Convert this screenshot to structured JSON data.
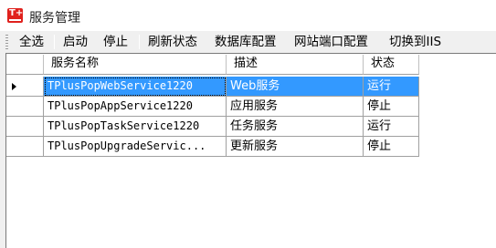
{
  "window": {
    "title": "服务管理",
    "icon": "app-logo-icon"
  },
  "toolbar": {
    "select_all": "全选",
    "start": "启动",
    "stop": "停止",
    "refresh": "刷新状态",
    "db_config": "数据库配置",
    "site_port_config": "网站端口配置",
    "switch_iis": "切换到IIS"
  },
  "grid": {
    "columns": [
      "服务名称",
      "描述",
      "状态"
    ],
    "selected_row": 0,
    "rows": [
      {
        "name": "TPlusPopWebService1220",
        "desc": "Web服务",
        "status": "运行"
      },
      {
        "name": "TPlusPopAppService1220",
        "desc": "应用服务",
        "status": "停止"
      },
      {
        "name": "TPlusPopTaskService1220",
        "desc": "任务服务",
        "status": "运行"
      },
      {
        "name": "TPlusPopUpgradeServic...",
        "desc": "更新服务",
        "status": "停止"
      }
    ]
  },
  "colors": {
    "selection": "#3399ff",
    "brand": "#e0211d"
  }
}
